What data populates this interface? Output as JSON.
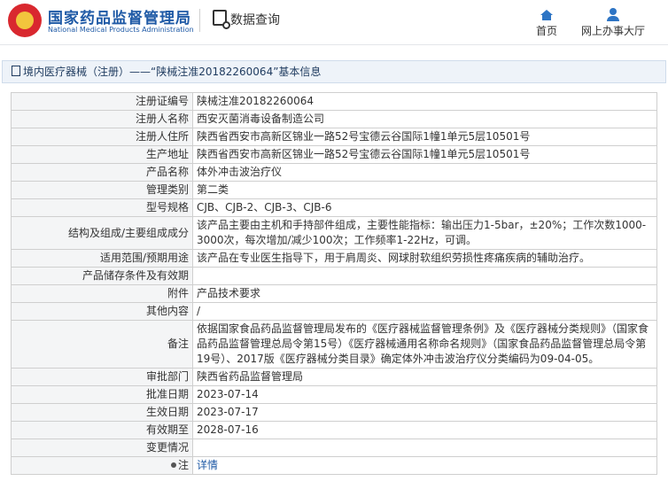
{
  "header": {
    "brand_cn": "国家药品监督管理局",
    "brand_en": "National Medical Products Administration",
    "query_label": "数据查询",
    "nav": [
      {
        "label": "首页",
        "icon": "home-icon"
      },
      {
        "label": "网上办事大厅",
        "icon": "user-icon"
      }
    ]
  },
  "breadcrumb": "境内医疗器械（注册）——“陕械注准20182260064”基本信息",
  "rows": [
    {
      "label": "注册证编号",
      "value": "陕械注准20182260064"
    },
    {
      "label": "注册人名称",
      "value": "西安灭菌消毒设备制造公司"
    },
    {
      "label": "注册人住所",
      "value": "陕西省西安市高新区锦业一路52号宝德云谷国际1幢1单元5层10501号"
    },
    {
      "label": "生产地址",
      "value": "陕西省西安市高新区锦业一路52号宝德云谷国际1幢1单元5层10501号"
    },
    {
      "label": "产品名称",
      "value": "体外冲击波治疗仪"
    },
    {
      "label": "管理类别",
      "value": "第二类"
    },
    {
      "label": "型号规格",
      "value": "CJB、CJB-2、CJB-3、CJB-6"
    },
    {
      "label": "结构及组成/主要组成成分",
      "value": "该产品主要由主机和手持部件组成，主要性能指标：输出压力1-5bar，±20%；工作次数1000-3000次，每次增加/减少100次；工作频率1-22Hz，可调。"
    },
    {
      "label": "适用范围/预期用途",
      "value": "该产品在专业医生指导下，用于肩周炎、网球肘软组织劳损性疼痛疾病的辅助治疗。"
    },
    {
      "label": "产品储存条件及有效期",
      "value": ""
    },
    {
      "label": "附件",
      "value": "产品技术要求"
    },
    {
      "label": "其他内容",
      "value": "/"
    },
    {
      "label": "备注",
      "value": "依据国家食品药品监督管理局发布的《医疗器械监督管理条例》及《医疗器械分类规则》（国家食品药品监督管理总局令第15号）《医疗器械通用名称命名规则》（国家食品药品监督管理总局令第19号）、2017版《医疗器械分类目录》确定体外冲击波治疗仪分类编码为09-04-05。"
    },
    {
      "label": "审批部门",
      "value": "陕西省药品监督管理局"
    },
    {
      "label": "批准日期",
      "value": "2023-07-14"
    },
    {
      "label": "生效日期",
      "value": "2023-07-17"
    },
    {
      "label": "有效期至",
      "value": "2028-07-16"
    },
    {
      "label": "变更情况",
      "value": ""
    }
  ],
  "note": {
    "label": "注",
    "link": "详情"
  }
}
